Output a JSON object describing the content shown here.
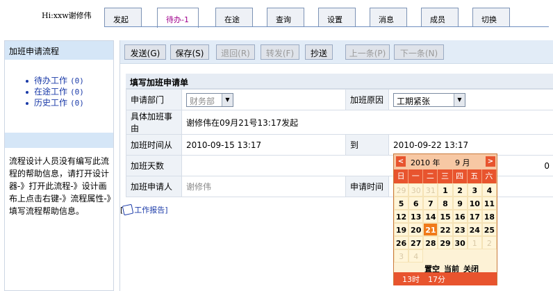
{
  "header": {
    "greeting": "Hi:xxw谢修伟",
    "tabs": [
      {
        "label": "发起"
      },
      {
        "label": "待办-1",
        "active": true
      },
      {
        "label": "在途"
      },
      {
        "label": "查询"
      },
      {
        "label": "设置"
      },
      {
        "label": "消息"
      },
      {
        "label": "成员"
      },
      {
        "label": "切换"
      }
    ]
  },
  "sidebar": {
    "title": "加班申请流程",
    "items": [
      {
        "label": "待办工作",
        "count": "(0)"
      },
      {
        "label": "在途工作",
        "count": "(0)"
      },
      {
        "label": "历史工作",
        "count": "(0)"
      }
    ],
    "help_text": "流程设计人员没有编写此流程的帮助信息，请打开设计器-》打开此流程-》设计画布上点击右键-》流程属性-》填写流程帮助信息。"
  },
  "toolbar": {
    "buttons": [
      {
        "label": "发送(G)",
        "enabled": true
      },
      {
        "label": "保存(S)",
        "enabled": true
      },
      {
        "label": "退回(R)",
        "enabled": false
      },
      {
        "label": "转发(F)",
        "enabled": false
      },
      {
        "label": "抄送",
        "enabled": true
      },
      {
        "label": "上一条(P)",
        "enabled": false
      },
      {
        "label": "下一条(N)",
        "enabled": false
      }
    ]
  },
  "form": {
    "title": "填写加班申请单",
    "dept_label": "申请部门",
    "dept_value": "财务部",
    "reason_label": "加班原因",
    "reason_value": "工期紧张",
    "detail_label": "具体加班事由",
    "detail_value": "谢修伟在09月21号13:17发起",
    "from_label": "加班时间从",
    "from_value": "2010-09-15 13:17",
    "to_label": "到",
    "to_value": "2010-09-22 13:17",
    "days_label": "加班天数",
    "days_value": "0",
    "applicant_label": "加班申请人",
    "applicant_value": "谢修伟",
    "apply_time_label": "申请时间"
  },
  "report_link": "工作报告]",
  "calendar": {
    "prev": "<",
    "next": ">",
    "year": "2010 年",
    "month": "9 月",
    "weekdays": [
      "日",
      "一",
      "二",
      "三",
      "四",
      "五",
      "六"
    ],
    "days": [
      {
        "d": "29",
        "other": true
      },
      {
        "d": "30",
        "other": true
      },
      {
        "d": "31",
        "other": true
      },
      {
        "d": "1"
      },
      {
        "d": "2"
      },
      {
        "d": "3"
      },
      {
        "d": "4"
      },
      {
        "d": "5"
      },
      {
        "d": "6"
      },
      {
        "d": "7"
      },
      {
        "d": "8"
      },
      {
        "d": "9"
      },
      {
        "d": "10"
      },
      {
        "d": "11"
      },
      {
        "d": "12"
      },
      {
        "d": "13"
      },
      {
        "d": "14"
      },
      {
        "d": "15"
      },
      {
        "d": "16"
      },
      {
        "d": "17"
      },
      {
        "d": "18"
      },
      {
        "d": "19"
      },
      {
        "d": "20"
      },
      {
        "d": "21",
        "today": true
      },
      {
        "d": "22"
      },
      {
        "d": "23"
      },
      {
        "d": "24"
      },
      {
        "d": "25"
      },
      {
        "d": "26"
      },
      {
        "d": "27"
      },
      {
        "d": "28"
      },
      {
        "d": "29"
      },
      {
        "d": "30"
      },
      {
        "d": "1",
        "other": true
      },
      {
        "d": "2",
        "other": true
      },
      {
        "d": "3",
        "other": true
      },
      {
        "d": "4",
        "other": true
      }
    ],
    "footer": [
      "置空",
      "当前",
      "关闭"
    ],
    "hour": "13时",
    "minute": "17分"
  }
}
